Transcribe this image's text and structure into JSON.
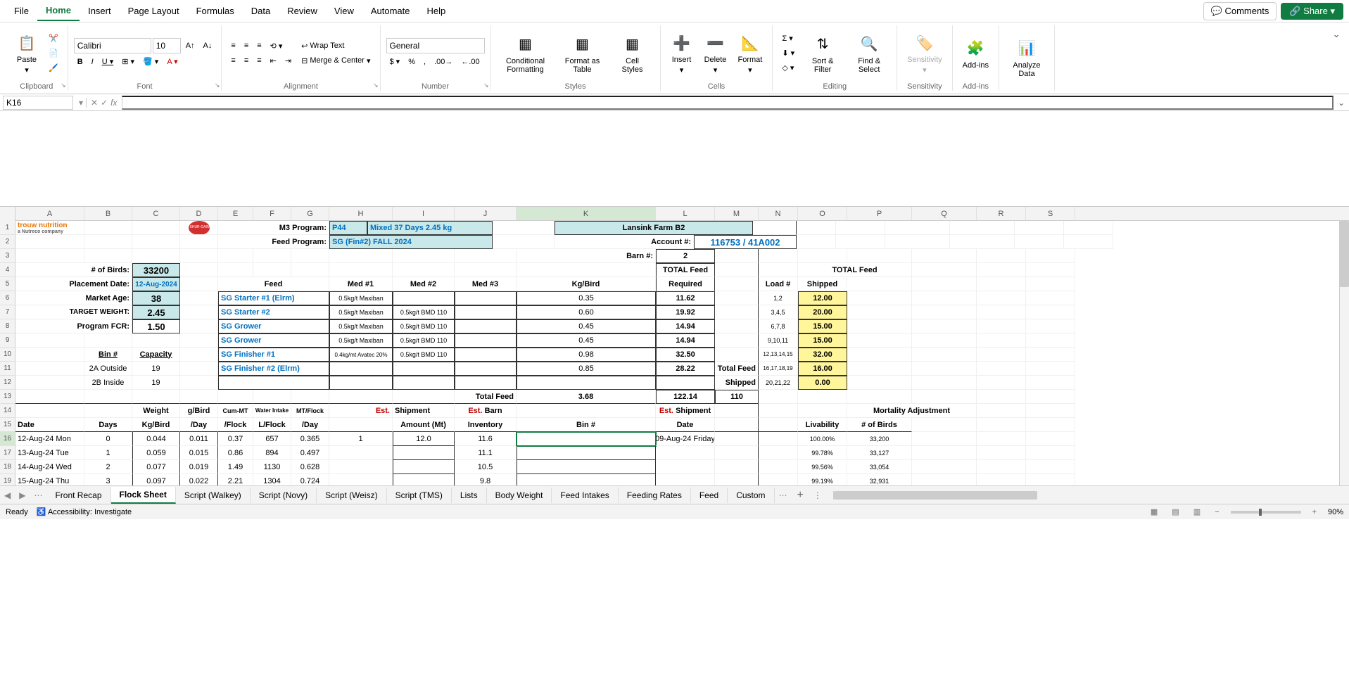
{
  "menu": {
    "tabs": [
      "File",
      "Home",
      "Insert",
      "Page Layout",
      "Formulas",
      "Data",
      "Review",
      "View",
      "Automate",
      "Help"
    ],
    "active": 1,
    "comments": "Comments",
    "share": "Share"
  },
  "ribbon": {
    "clipboard": {
      "label": "Clipboard",
      "paste": "Paste"
    },
    "font": {
      "label": "Font",
      "name": "Calibri",
      "size": "10"
    },
    "align": {
      "label": "Alignment",
      "wrap": "Wrap Text",
      "merge": "Merge & Center"
    },
    "number": {
      "label": "Number",
      "format": "General"
    },
    "styles": {
      "label": "Styles",
      "cond": "Conditional Formatting",
      "table": "Format as Table",
      "cell": "Cell Styles"
    },
    "cells": {
      "label": "Cells",
      "insert": "Insert",
      "delete": "Delete",
      "format": "Format"
    },
    "editing": {
      "label": "Editing",
      "sort": "Sort & Filter",
      "find": "Find & Select"
    },
    "sens": {
      "label": "Sensitivity",
      "btn": "Sensitivity"
    },
    "addins": {
      "label": "Add-ins",
      "btn": "Add-ins"
    },
    "analyze": {
      "label": "",
      "btn": "Analyze Data"
    }
  },
  "namebox": "K16",
  "cols": [
    "A",
    "B",
    "C",
    "D",
    "E",
    "F",
    "G",
    "H",
    "I",
    "J",
    "K",
    "L",
    "M",
    "N",
    "O",
    "P",
    "Q",
    "R",
    "S"
  ],
  "rows": [
    "1",
    "2",
    "3",
    "4",
    "5",
    "6",
    "7",
    "8",
    "9",
    "10",
    "11",
    "12",
    "13",
    "14",
    "15",
    "16",
    "17",
    "18",
    "19"
  ],
  "activeCol": 10,
  "activeRow": 15,
  "data": {
    "r1": {
      "m3": "M3 Program:",
      "p44": "P44",
      "mixed": "Mixed 37 Days 2.45 kg",
      "farm": "Lansink Farm B2",
      "logoA": "trouw nutrition",
      "logoAsub": "a Nutreco company"
    },
    "r2": {
      "feedProg": "Feed Program:",
      "sg": "SG (Fin#2) FALL 2024",
      "acct": "Account #:",
      "acctv": "116753 / 41A002"
    },
    "r3": {
      "barn": "Barn #:",
      "barnv": "2"
    },
    "r4": {
      "birds": "# of Birds:",
      "birdsv": "33200",
      "tf": "TOTAL Feed",
      "tf2": "TOTAL Feed"
    },
    "r5": {
      "pd": "Placement Date:",
      "pdv": "12-Aug-2024",
      "feed": "Feed",
      "m1": "Med #1",
      "m2": "Med #2",
      "m3": "Med #3",
      "kg": "Kg/Bird",
      "req": "Required",
      "load": "Load #",
      "ship": "Shipped"
    },
    "r6": {
      "ma": "Market Age:",
      "mav": "38",
      "f": "SG Starter #1 (Elrm)",
      "m1": "0.5kg/t Maxiban",
      "kg": "0.35",
      "r": "11.62",
      "l": "1,2",
      "s": "12.00"
    },
    "r7": {
      "tw": "TARGET WEIGHT:",
      "twv": "2.45",
      "f": "SG Starter #2",
      "m1": "0.5kg/t Maxiban",
      "m2": "0.5kg/t BMD 110",
      "kg": "0.60",
      "r": "19.92",
      "l": "3,4,5",
      "s": "20.00"
    },
    "r8": {
      "fcr": "Program FCR:",
      "fcrv": "1.50",
      "f": "SG Grower",
      "m1": "0.5kg/t Maxiban",
      "m2": "0.5kg/t BMD 110",
      "kg": "0.45",
      "r": "14.94",
      "l": "6,7,8",
      "s": "15.00"
    },
    "r9": {
      "f": "SG Grower",
      "m1": "0.5kg/t Maxiban",
      "m2": "0.5kg/t BMD 110",
      "kg": "0.45",
      "r": "14.94",
      "l": "9,10,11",
      "s": "15.00"
    },
    "r10": {
      "bin": "Bin #",
      "cap": "Capacity",
      "f": "SG Finisher #1",
      "m1": "0.4kg/mt Avatec 20%",
      "m2": "0.5kg/t BMD 110",
      "kg": "0.98",
      "r": "32.50",
      "l": "12,13,14,15",
      "s": "32.00"
    },
    "r11": {
      "b": "2A Outside",
      "c": "19",
      "f": "SG Finisher #2 (Elrm)",
      "kg": "0.85",
      "r": "28.22",
      "tfl": "Total Feed",
      "l": "16,17,18,19",
      "s": "16.00"
    },
    "r12": {
      "b": "2B Inside",
      "c": "19",
      "tfl": "Shipped",
      "l": "20,21,22",
      "s": "0.00"
    },
    "r13": {
      "tf": "Total Feed",
      "kg": "3.68",
      "r": "122.14",
      "n": "110"
    },
    "r14": {
      "w": "Weight",
      "gb": "g/Bird",
      "cm": "Cum-MT",
      "wi": "Water Intake",
      "mf": "MT/Flock",
      "est": "Est.",
      "ship": "Shipment",
      "est2": "Est.",
      "barn": "Barn",
      "est3": "Est.",
      "ship2": "Shipment",
      "mort": "Mortality Adjustment"
    },
    "r15": {
      "date": "Date",
      "days": "Days",
      "kgb": "Kg/Bird",
      "day": "/Day",
      "fl": "/Flock",
      "lf": "L/Flock",
      "day2": "/Day",
      "amt": "Amount (Mt)",
      "inv": "Inventory",
      "bin": "Bin #",
      "dt": "Date",
      "liv": "Livability",
      "nb": "# of Birds"
    },
    "r16": {
      "d": "12-Aug-24 Mon",
      "dy": "0",
      "w": "0.044",
      "gb": "0.011",
      "cm": "0.37",
      "wi": "657",
      "mf": "0.365",
      "h": "1",
      "amt": "12.0",
      "inv": "11.6",
      "dt": "09-Aug-24 Friday",
      "liv": "100.00%",
      "nb": "33,200"
    },
    "r17": {
      "d": "13-Aug-24 Tue",
      "dy": "1",
      "w": "0.059",
      "gb": "0.015",
      "cm": "0.86",
      "wi": "894",
      "mf": "0.497",
      "inv": "11.1",
      "liv": "99.78%",
      "nb": "33,127"
    },
    "r18": {
      "d": "14-Aug-24 Wed",
      "dy": "2",
      "w": "0.077",
      "gb": "0.019",
      "cm": "1.49",
      "wi": "1130",
      "mf": "0.628",
      "inv": "10.5",
      "liv": "99.56%",
      "nb": "33,054"
    },
    "r19": {
      "d": "15-Aug-24 Thu",
      "dy": "3",
      "w": "0.097",
      "gb": "0.022",
      "cm": "2.21",
      "wi": "1304",
      "mf": "0.724",
      "inv": "9.8",
      "liv": "99.19%",
      "nb": "32,931"
    }
  },
  "tabs": {
    "list": [
      "Front Recap",
      "Flock Sheet",
      "Script (Walkey)",
      "Script (Novy)",
      "Script (Weisz)",
      "Script (TMS)",
      "Lists",
      "Body Weight",
      "Feed Intakes",
      "Feeding Rates",
      "Feed",
      "Custom"
    ],
    "active": 1
  },
  "status": {
    "ready": "Ready",
    "acc": "Accessibility: Investigate",
    "zoom": "90%"
  }
}
